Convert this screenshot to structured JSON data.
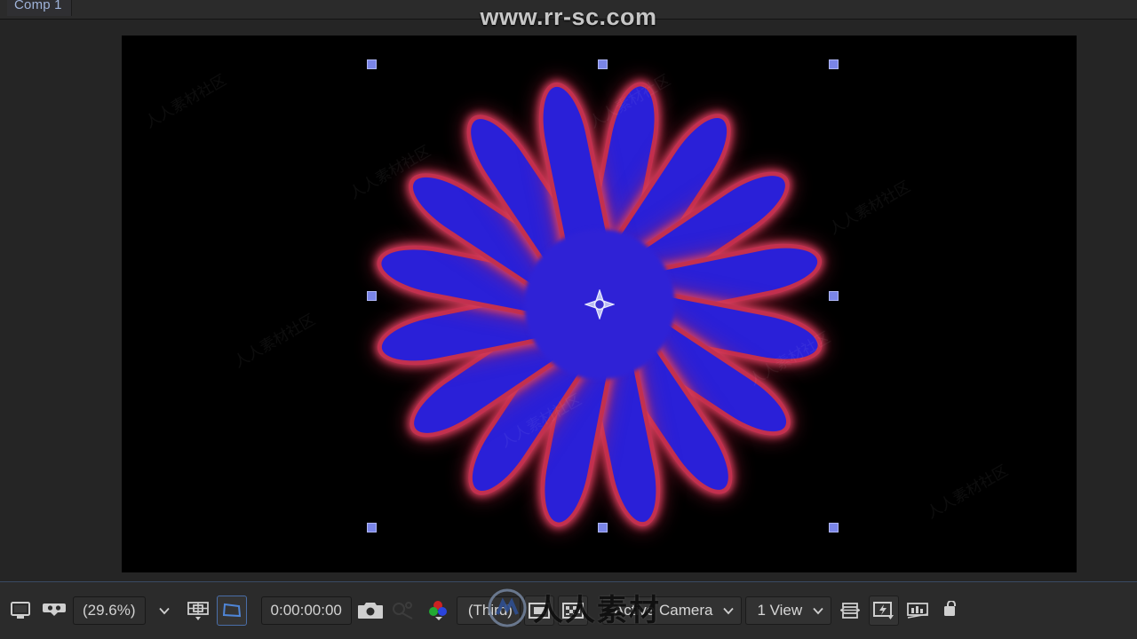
{
  "window": {
    "tab_label": "Comp 1"
  },
  "watermarks": {
    "top_url": "www.rr-sc.com",
    "bottom_cn": "人人素材",
    "tile_text": "人人素材社区"
  },
  "viewer": {
    "composition_name": "Comp 1",
    "background_color": "#000000",
    "selection_handle_color": "#7a85e8",
    "anchor_point_label": "anchor-point"
  },
  "artwork": {
    "description": "radial neon flower",
    "petal_count": 16,
    "petal_fill_color": "#2a20d8",
    "petal_glow_color": "#c3304f",
    "core_color": "#2f22d6"
  },
  "toolbar": {
    "main_viewer_label": "main-viewer",
    "always_preview_label": "always-preview-this-view",
    "magnification": "(29.6%)",
    "choose_grid_label": "choose-grid-and-guide-options",
    "mask_visibility_label": "toggle-mask-and-shape-path-visibility",
    "timecode": "0:00:00:00",
    "snapshot_label": "take-snapshot",
    "show_snapshot_label": "show-snapshot",
    "channel_label": "show-channel-and-color-management",
    "resolution": "(Third)",
    "region_of_interest_label": "region-of-interest",
    "transparency_grid_label": "toggle-transparency-grid",
    "camera_view": "Active Camera",
    "view_layout": "1 View",
    "pixel_aspect_label": "toggle-pixel-aspect-ratio-correction",
    "fast_previews_label": "fast-previews",
    "timeline_label": "comp-flowchart-view",
    "reset_exposure_label": "reset-exposure"
  }
}
